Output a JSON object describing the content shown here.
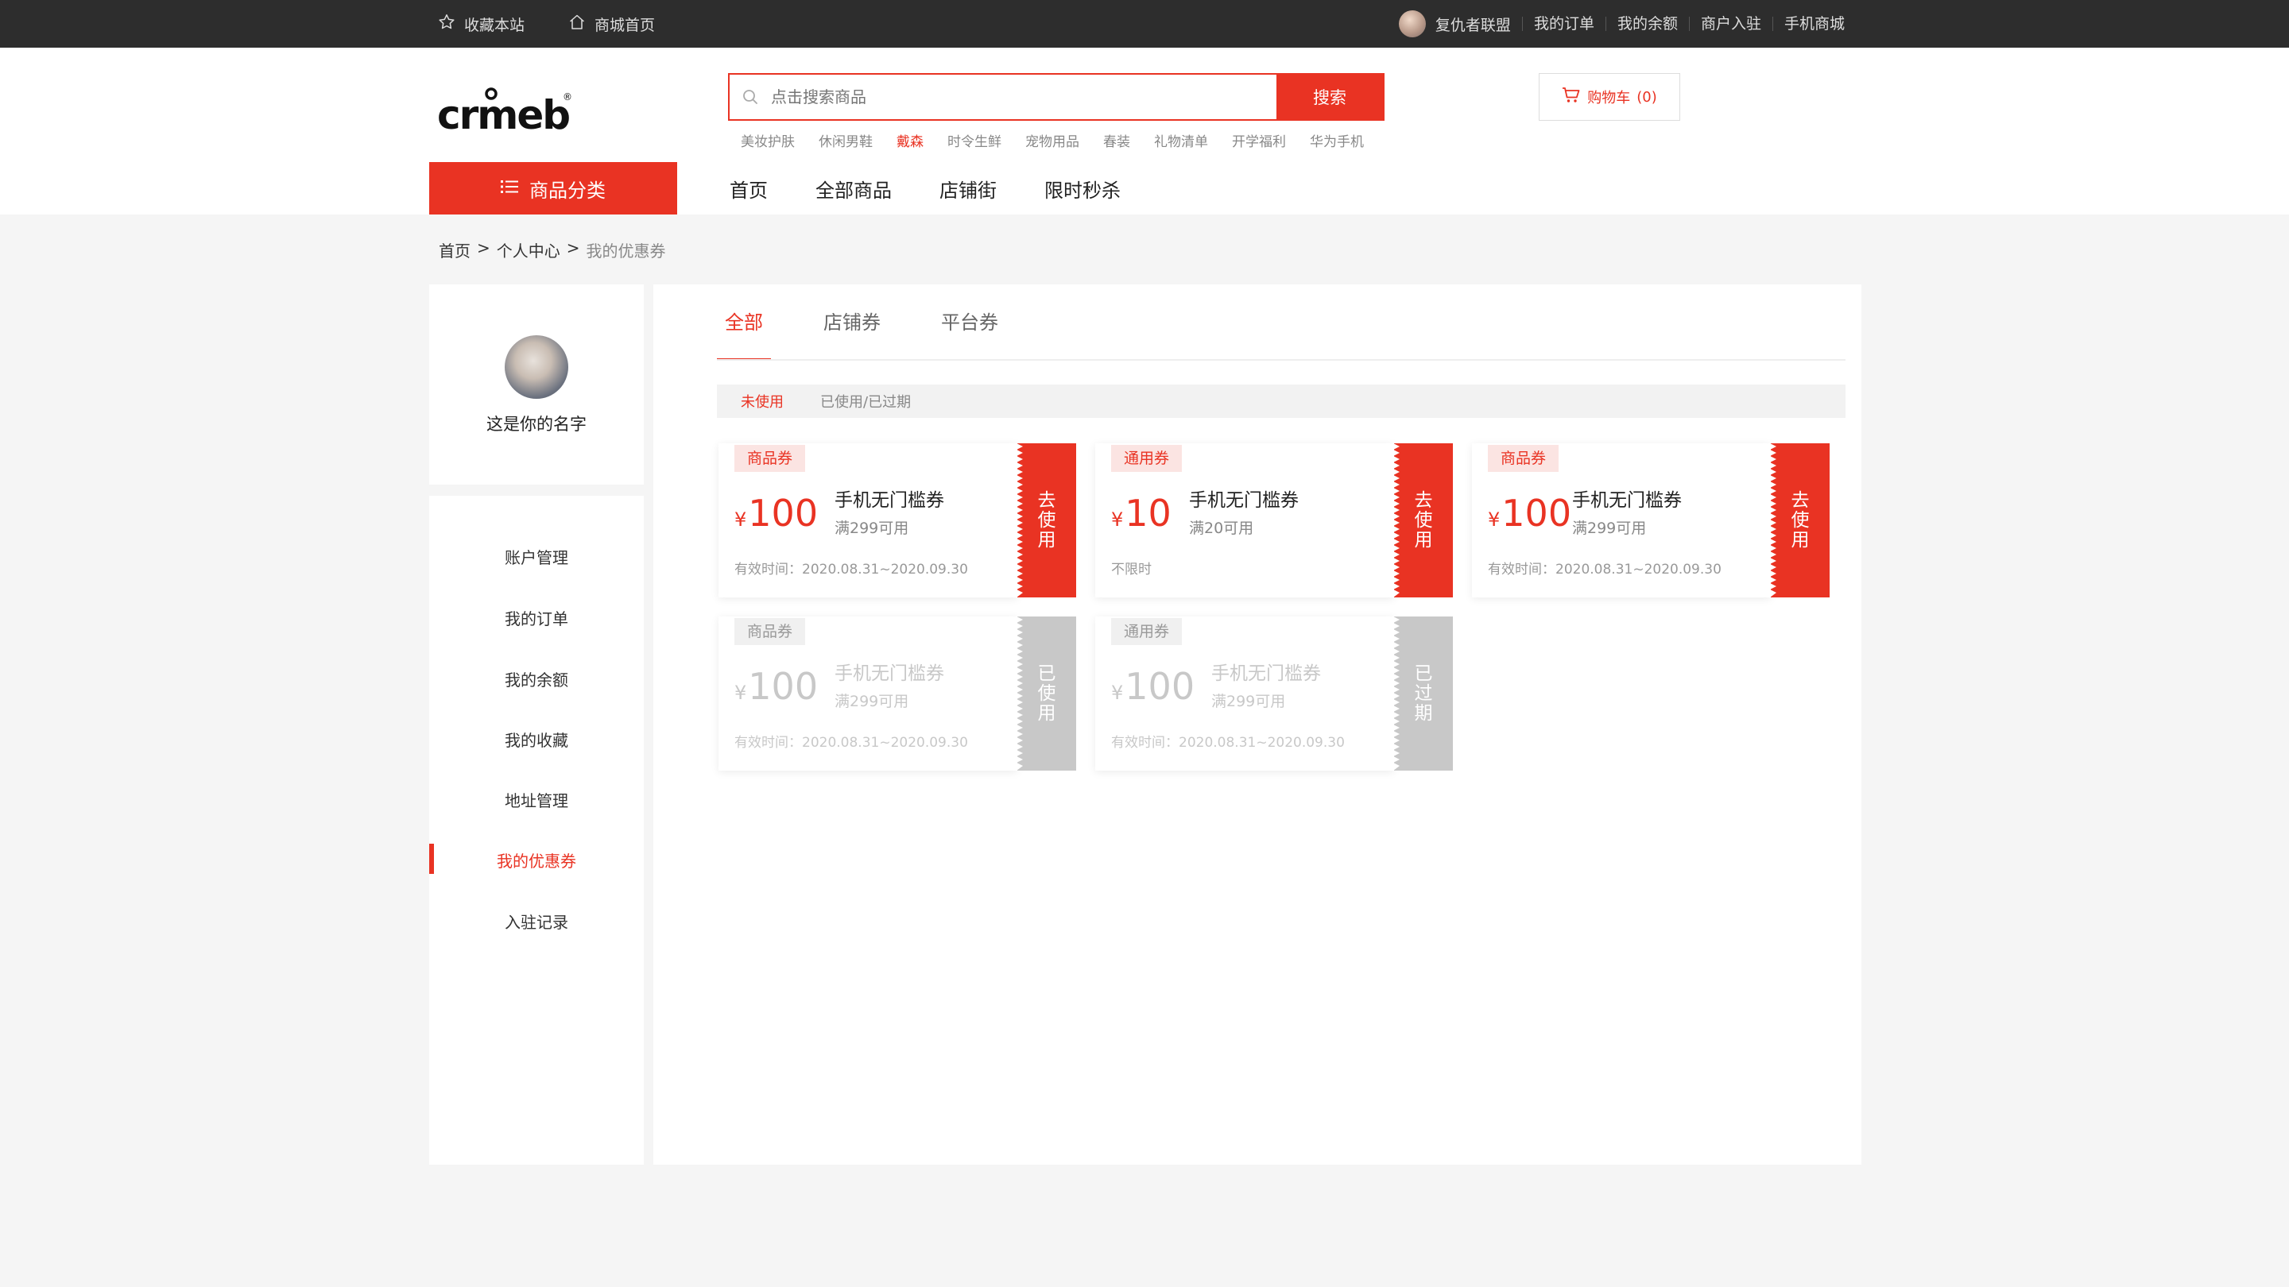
{
  "topbar": {
    "left": [
      {
        "label": "收藏本站",
        "icon": "star-icon"
      },
      {
        "label": "商城首页",
        "icon": "home-icon"
      }
    ],
    "user_name": "复仇者联盟",
    "right_links": [
      "我的订单",
      "我的余额",
      "商户入驻",
      "手机商城"
    ]
  },
  "header": {
    "logo_text": "crmeb",
    "search_placeholder": "点击搜索商品",
    "search_button": "搜索",
    "hot_words": [
      "美妆护肤",
      "休闲男鞋",
      "戴森",
      "时令生鲜",
      "宠物用品",
      "春装",
      "礼物清单",
      "开学福利",
      "华为手机"
    ],
    "hot_highlight_index": 2,
    "cart_label": "购物车",
    "cart_count": "(0)",
    "category_button": "商品分类",
    "nav": [
      "首页",
      "全部商品",
      "店铺街",
      "限时秒杀"
    ]
  },
  "breadcrumb": {
    "home": "首页",
    "sep": ">",
    "center": "个人中心",
    "current": "我的优惠券"
  },
  "profile": {
    "name": "这是你的名字"
  },
  "menu": {
    "items": [
      "账户管理",
      "我的订单",
      "我的余额",
      "我的收藏",
      "地址管理",
      "我的优惠券",
      "入驻记录"
    ],
    "active_index": 5
  },
  "tabs": {
    "items": [
      "全部",
      "店铺券",
      "平台券"
    ],
    "active_index": 0
  },
  "subtabs": {
    "items": [
      "未使用",
      "已使用/已过期"
    ],
    "active_index": 0
  },
  "coupons": [
    {
      "tag": "商品券",
      "currency": "¥",
      "amount": "100",
      "title": "手机无门槛券",
      "condition": "满299可用",
      "validity": "有效时间：2020.08.31~2020.09.30",
      "action": "去使用",
      "disabled": false
    },
    {
      "tag": "通用券",
      "currency": "¥",
      "amount": "10",
      "title": "手机无门槛券",
      "condition": "满20可用",
      "validity": "不限时",
      "action": "去使用",
      "disabled": false
    },
    {
      "tag": "商品券",
      "currency": "¥",
      "amount": "100",
      "title": "手机无门槛券",
      "condition": "满299可用",
      "validity": "有效时间：2020.08.31~2020.09.30",
      "action": "去使用",
      "disabled": false
    },
    {
      "tag": "商品券",
      "currency": "¥",
      "amount": "100",
      "title": "手机无门槛券",
      "condition": "满299可用",
      "validity": "有效时间：2020.08.31~2020.09.30",
      "action": "已使用",
      "disabled": true
    },
    {
      "tag": "通用券",
      "currency": "¥",
      "amount": "100",
      "title": "手机无门槛券",
      "condition": "满299可用",
      "validity": "有效时间：2020.08.31~2020.09.30",
      "action": "已过期",
      "disabled": true
    }
  ],
  "colors": {
    "accent": "#e93323",
    "topbar": "#2d2d2d",
    "disabled": "#c8c8c8"
  }
}
